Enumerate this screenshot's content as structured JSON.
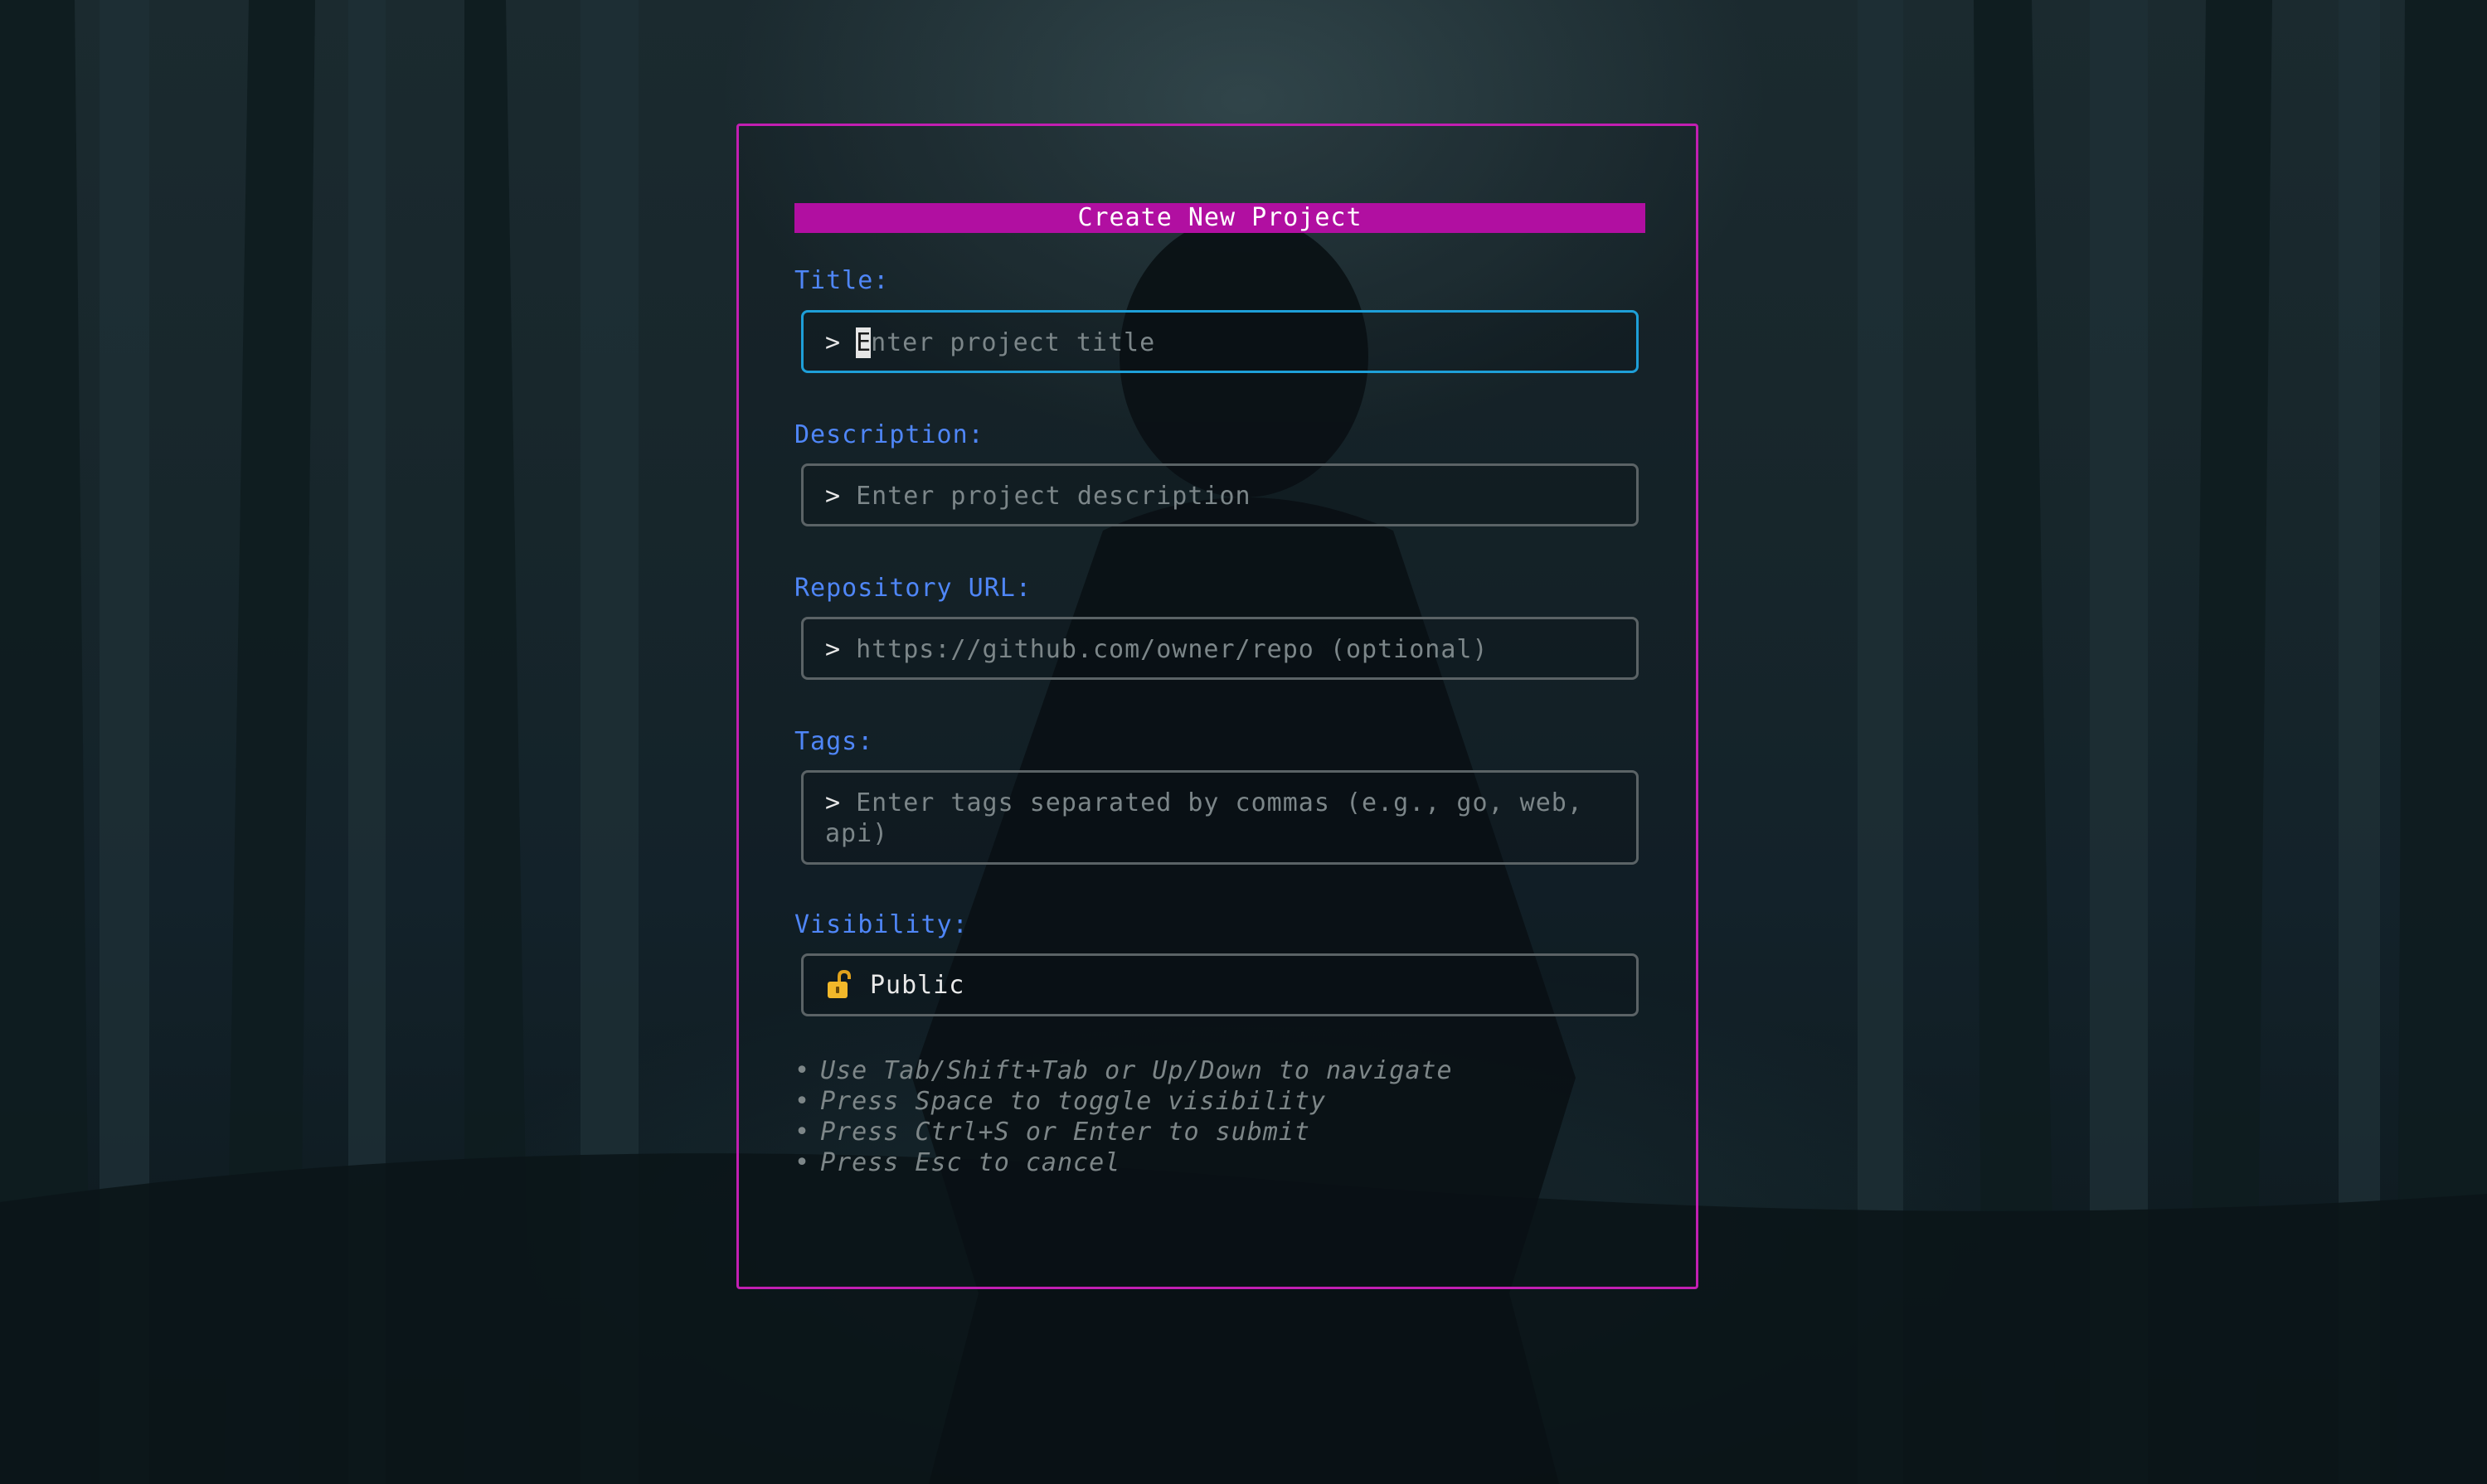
{
  "form": {
    "title": "Create New Project",
    "fields": {
      "title": {
        "label": "Title:",
        "prompt": ">",
        "cursor_char": "E",
        "placeholder_rest": "nter project title"
      },
      "description": {
        "label": "Description:",
        "prompt": ">",
        "placeholder": "Enter project description"
      },
      "repository": {
        "label": "Repository URL:",
        "prompt": ">",
        "placeholder": "https://github.com/owner/repo (optional)"
      },
      "tags": {
        "label": "Tags:",
        "prompt": ">",
        "placeholder": "Enter tags separated by commas (e.g., go, web, api)"
      },
      "visibility": {
        "label": "Visibility:",
        "value": "Public",
        "icon": "unlocked-padlock-icon"
      }
    },
    "help": [
      "Use Tab/Shift+Tab or Up/Down to navigate",
      "Press Space to toggle visibility",
      "Press Ctrl+S or Enter to submit",
      "Press Esc to cancel"
    ],
    "help_bullet": "•"
  },
  "colors": {
    "panel_border": "#c21fb2",
    "title_bar": "#b10fa1",
    "label": "#4f86f7",
    "focused_border": "#1e9fd8",
    "input_border": "#5b6366",
    "placeholder": "#7c8689"
  }
}
